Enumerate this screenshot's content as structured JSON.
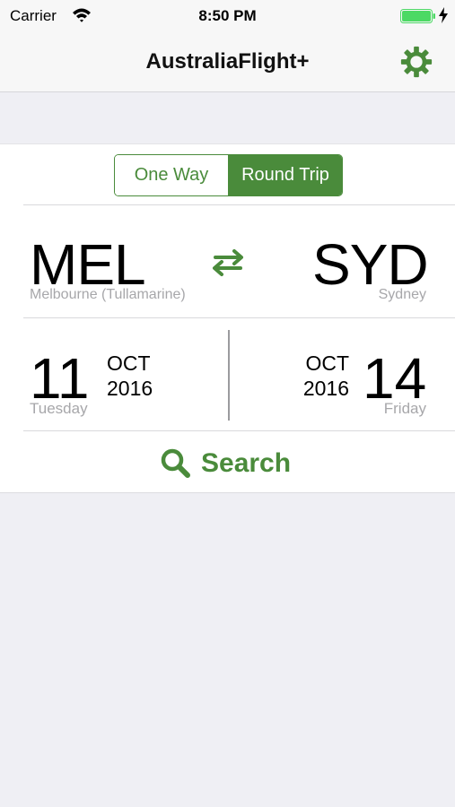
{
  "status_bar": {
    "carrier": "Carrier",
    "time": "8:50 PM",
    "battery_color": "#4cd964"
  },
  "nav": {
    "title": "AustraliaFlight+",
    "settings_icon": "gear-icon"
  },
  "trip_type": {
    "options": [
      "One Way",
      "Round Trip"
    ],
    "selected": "Round Trip"
  },
  "origin": {
    "code": "MEL",
    "city": "Melbourne (Tullamarine)"
  },
  "destination": {
    "code": "SYD",
    "city": "Sydney"
  },
  "depart": {
    "day": "11",
    "month": "OCT",
    "year": "2016",
    "weekday": "Tuesday"
  },
  "return": {
    "day": "14",
    "month": "OCT",
    "year": "2016",
    "weekday": "Friday"
  },
  "search": {
    "label": "Search",
    "icon": "search-icon"
  },
  "colors": {
    "accent": "#4a8b3b",
    "background": "#efeff4",
    "secondary_text": "#a7a7aa"
  }
}
